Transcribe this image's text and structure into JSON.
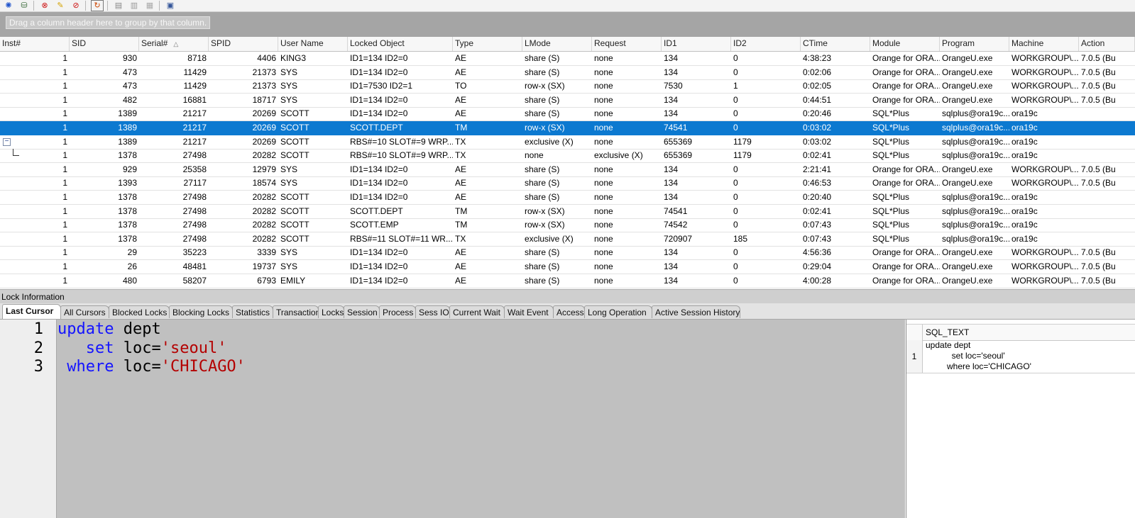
{
  "toolbar": {
    "icons": [
      "gear-sessions-icon",
      "kill-session-icon",
      "disconnect-icon",
      "highlight-icon",
      "clear-icon",
      "refresh-icon",
      "lock-icon",
      "unlock-icon",
      "unlock-all-icon",
      "clipboard-icon"
    ]
  },
  "group_panel": {
    "hint": "Drag a column header here to group by that column."
  },
  "grid": {
    "columns": [
      "Inst#",
      "SID",
      "Serial#",
      "SPID",
      "User Name",
      "Locked Object",
      "Type",
      "LMode",
      "Request",
      "ID1",
      "ID2",
      "CTime",
      "Module",
      "Program",
      "Machine",
      "Action"
    ],
    "rows": [
      {
        "inst": "1",
        "sid": "930",
        "serial": "8718",
        "spid": "4406",
        "user": "KING3",
        "obj": "ID1=134 ID2=0",
        "type": "AE",
        "lmode": "share (S)",
        "request": "none",
        "id1": "134",
        "id2": "0",
        "ctime": "4:38:23",
        "module": "Orange for ORA...",
        "program": "OrangeU.exe",
        "machine": "WORKGROUP\\...",
        "action": "7.0.5 (Bu"
      },
      {
        "inst": "1",
        "sid": "473",
        "serial": "11429",
        "spid": "21373",
        "user": "SYS",
        "obj": "ID1=134 ID2=0",
        "type": "AE",
        "lmode": "share (S)",
        "request": "none",
        "id1": "134",
        "id2": "0",
        "ctime": "0:02:06",
        "module": "Orange for ORA...",
        "program": "OrangeU.exe",
        "machine": "WORKGROUP\\...",
        "action": "7.0.5 (Bu"
      },
      {
        "inst": "1",
        "sid": "473",
        "serial": "11429",
        "spid": "21373",
        "user": "SYS",
        "obj": "ID1=7530 ID2=1",
        "type": "TO",
        "lmode": "row-x (SX)",
        "request": "none",
        "id1": "7530",
        "id2": "1",
        "ctime": "0:02:05",
        "module": "Orange for ORA...",
        "program": "OrangeU.exe",
        "machine": "WORKGROUP\\...",
        "action": "7.0.5 (Bu"
      },
      {
        "inst": "1",
        "sid": "482",
        "serial": "16881",
        "spid": "18717",
        "user": "SYS",
        "obj": "ID1=134 ID2=0",
        "type": "AE",
        "lmode": "share (S)",
        "request": "none",
        "id1": "134",
        "id2": "0",
        "ctime": "0:44:51",
        "module": "Orange for ORA...",
        "program": "OrangeU.exe",
        "machine": "WORKGROUP\\...",
        "action": "7.0.5 (Bu"
      },
      {
        "inst": "1",
        "sid": "1389",
        "serial": "21217",
        "spid": "20269",
        "user": "SCOTT",
        "obj": "ID1=134 ID2=0",
        "type": "AE",
        "lmode": "share (S)",
        "request": "none",
        "id1": "134",
        "id2": "0",
        "ctime": "0:20:46",
        "module": "SQL*Plus",
        "program": "sqlplus@ora19c...",
        "machine": "ora19c",
        "action": ""
      },
      {
        "inst": "1",
        "sid": "1389",
        "serial": "21217",
        "spid": "20269",
        "user": "SCOTT",
        "obj": "SCOTT.DEPT",
        "type": "TM",
        "lmode": "row-x (SX)",
        "request": "none",
        "id1": "74541",
        "id2": "0",
        "ctime": "0:03:02",
        "module": "SQL*Plus",
        "program": "sqlplus@ora19c...",
        "machine": "ora19c",
        "action": ""
      },
      {
        "inst": "1",
        "sid": "1389",
        "serial": "21217",
        "spid": "20269",
        "user": "SCOTT",
        "obj": "RBS#=10 SLOT#=9 WRP...",
        "type": "TX",
        "lmode": "exclusive (X)",
        "request": "none",
        "id1": "655369",
        "id2": "1179",
        "ctime": "0:03:02",
        "module": "SQL*Plus",
        "program": "sqlplus@ora19c...",
        "machine": "ora19c",
        "action": ""
      },
      {
        "inst": "1",
        "sid": "1378",
        "serial": "27498",
        "spid": "20282",
        "user": "SCOTT",
        "obj": "RBS#=10 SLOT#=9 WRP...",
        "type": "TX",
        "lmode": "none",
        "request": "exclusive (X)",
        "id1": "655369",
        "id2": "1179",
        "ctime": "0:02:41",
        "module": "SQL*Plus",
        "program": "sqlplus@ora19c...",
        "machine": "ora19c",
        "action": ""
      },
      {
        "inst": "1",
        "sid": "929",
        "serial": "25358",
        "spid": "12979",
        "user": "SYS",
        "obj": "ID1=134 ID2=0",
        "type": "AE",
        "lmode": "share (S)",
        "request": "none",
        "id1": "134",
        "id2": "0",
        "ctime": "2:21:41",
        "module": "Orange for ORA...",
        "program": "OrangeU.exe",
        "machine": "WORKGROUP\\...",
        "action": "7.0.5 (Bu"
      },
      {
        "inst": "1",
        "sid": "1393",
        "serial": "27117",
        "spid": "18574",
        "user": "SYS",
        "obj": "ID1=134 ID2=0",
        "type": "AE",
        "lmode": "share (S)",
        "request": "none",
        "id1": "134",
        "id2": "0",
        "ctime": "0:46:53",
        "module": "Orange for ORA...",
        "program": "OrangeU.exe",
        "machine": "WORKGROUP\\...",
        "action": "7.0.5 (Bu"
      },
      {
        "inst": "1",
        "sid": "1378",
        "serial": "27498",
        "spid": "20282",
        "user": "SCOTT",
        "obj": "ID1=134 ID2=0",
        "type": "AE",
        "lmode": "share (S)",
        "request": "none",
        "id1": "134",
        "id2": "0",
        "ctime": "0:20:40",
        "module": "SQL*Plus",
        "program": "sqlplus@ora19c...",
        "machine": "ora19c",
        "action": ""
      },
      {
        "inst": "1",
        "sid": "1378",
        "serial": "27498",
        "spid": "20282",
        "user": "SCOTT",
        "obj": "SCOTT.DEPT",
        "type": "TM",
        "lmode": "row-x (SX)",
        "request": "none",
        "id1": "74541",
        "id2": "0",
        "ctime": "0:02:41",
        "module": "SQL*Plus",
        "program": "sqlplus@ora19c...",
        "machine": "ora19c",
        "action": ""
      },
      {
        "inst": "1",
        "sid": "1378",
        "serial": "27498",
        "spid": "20282",
        "user": "SCOTT",
        "obj": "SCOTT.EMP",
        "type": "TM",
        "lmode": "row-x (SX)",
        "request": "none",
        "id1": "74542",
        "id2": "0",
        "ctime": "0:07:43",
        "module": "SQL*Plus",
        "program": "sqlplus@ora19c...",
        "machine": "ora19c",
        "action": ""
      },
      {
        "inst": "1",
        "sid": "1378",
        "serial": "27498",
        "spid": "20282",
        "user": "SCOTT",
        "obj": "RBS#=11 SLOT#=11 WR...",
        "type": "TX",
        "lmode": "exclusive (X)",
        "request": "none",
        "id1": "720907",
        "id2": "185",
        "ctime": "0:07:43",
        "module": "SQL*Plus",
        "program": "sqlplus@ora19c...",
        "machine": "ora19c",
        "action": ""
      },
      {
        "inst": "1",
        "sid": "29",
        "serial": "35223",
        "spid": "3339",
        "user": "SYS",
        "obj": "ID1=134 ID2=0",
        "type": "AE",
        "lmode": "share (S)",
        "request": "none",
        "id1": "134",
        "id2": "0",
        "ctime": "4:56:36",
        "module": "Orange for ORA...",
        "program": "OrangeU.exe",
        "machine": "WORKGROUP\\...",
        "action": "7.0.5 (Bu"
      },
      {
        "inst": "1",
        "sid": "26",
        "serial": "48481",
        "spid": "19737",
        "user": "SYS",
        "obj": "ID1=134 ID2=0",
        "type": "AE",
        "lmode": "share (S)",
        "request": "none",
        "id1": "134",
        "id2": "0",
        "ctime": "0:29:04",
        "module": "Orange for ORA...",
        "program": "OrangeU.exe",
        "machine": "WORKGROUP\\...",
        "action": "7.0.5 (Bu"
      },
      {
        "inst": "1",
        "sid": "480",
        "serial": "58207",
        "spid": "6793",
        "user": "EMILY",
        "obj": "ID1=134 ID2=0",
        "type": "AE",
        "lmode": "share (S)",
        "request": "none",
        "id1": "134",
        "id2": "0",
        "ctime": "4:00:28",
        "module": "Orange for ORA...",
        "program": "OrangeU.exe",
        "machine": "WORKGROUP\\...",
        "action": "7.0.5 (Bu"
      }
    ],
    "selected_row_index": 5,
    "expanded_row_index": 6,
    "child_row_index": 7
  },
  "lock_info": {
    "title": "Lock Information"
  },
  "tabs": [
    "Last Cursor",
    "All Cursors",
    "Blocked Locks",
    "Blocking Locks",
    "Statistics",
    "Transaction",
    "Locks",
    "Session",
    "Process",
    "Sess IO",
    "Current Wait",
    "Wait Event",
    "Access",
    "Long Operation",
    "Active Session History"
  ],
  "active_tab_index": 0,
  "editor": {
    "line_numbers": [
      "1",
      "2",
      "3"
    ],
    "lines": [
      [
        {
          "t": "update",
          "c": "kw"
        },
        {
          "t": " dept",
          "c": ""
        }
      ],
      [
        {
          "t": "   set",
          "c": "kw"
        },
        {
          "t": " loc=",
          "c": ""
        },
        {
          "t": "'seoul'",
          "c": "str"
        }
      ],
      [
        {
          "t": " where",
          "c": "kw"
        },
        {
          "t": " loc=",
          "c": ""
        },
        {
          "t": "'CHICAGO'",
          "c": "str"
        }
      ]
    ]
  },
  "result": {
    "column": "SQL_TEXT",
    "row_number": "1",
    "text": "update dept\n           set loc='seoul'\n         where loc='CHICAGO'"
  },
  "colors": {
    "selected_row": "#0c79d0",
    "keyword": "#1414ff",
    "string": "#b40000",
    "group_panel": "#a5a5a5",
    "editor_bg": "#c0c0c0"
  }
}
